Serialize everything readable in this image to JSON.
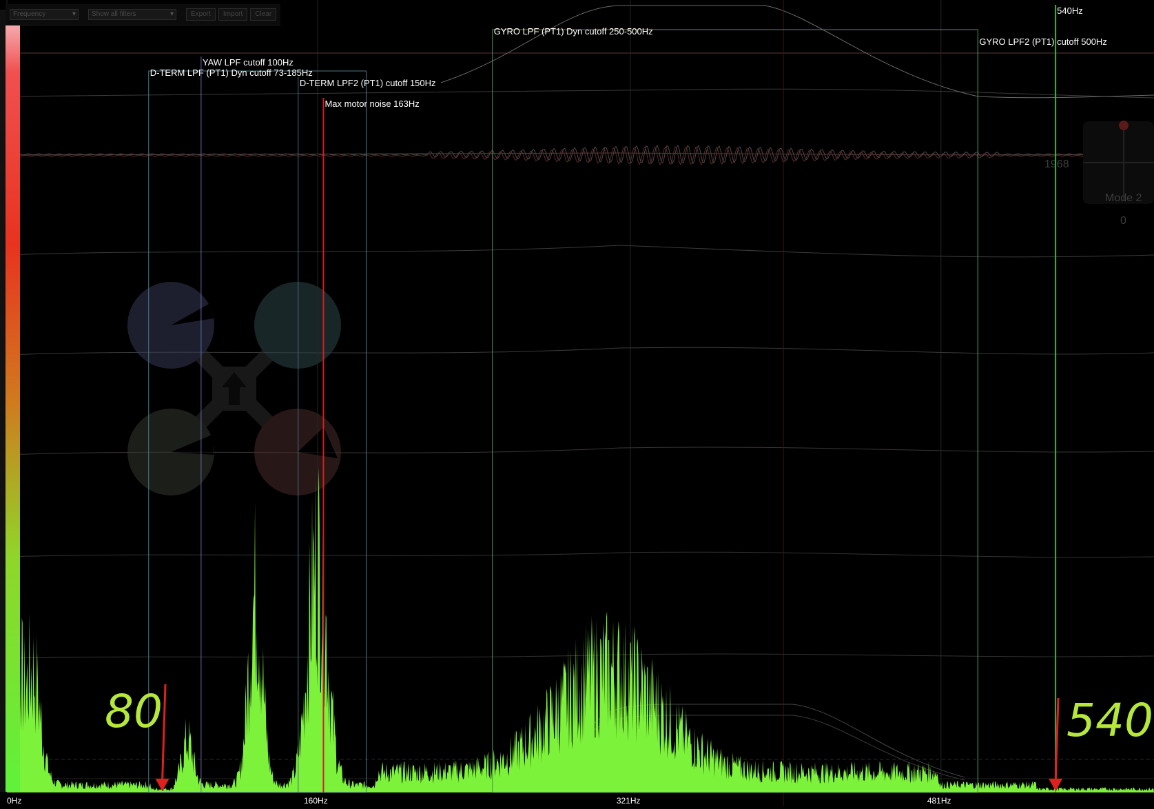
{
  "toolbar": {
    "spectrum_select": "Frequency",
    "filter_select": "Show all filters",
    "buttons": [
      "Export",
      "Import",
      "Clear"
    ]
  },
  "colors": {
    "background": "#000000",
    "spectrum": "#7df23a",
    "max_noise_marker": "#e02020",
    "gyro_lpf2_marker": "#33bb33",
    "annotation": "#b6e83a",
    "annotation_arrow": "#e02020"
  },
  "chart_data": {
    "type": "area",
    "x_axis": {
      "ticks": [
        "0Hz",
        "160Hz",
        "321Hz",
        "481Hz"
      ],
      "tick_values": [
        0,
        160,
        321,
        481
      ],
      "max": 588
    },
    "filters": [
      {
        "label": "D-TERM LPF (PT1) Dyn cutoff 73-185Hz",
        "from": 73,
        "to": 185
      },
      {
        "label": "YAW LPF cutoff 100Hz",
        "at": 100
      },
      {
        "label": "D-TERM LPF2 (PT1) cutoff 150Hz",
        "at": 150
      },
      {
        "label": "Max motor noise 163Hz",
        "at": 163
      },
      {
        "label": "GYRO LPF (PT1) Dyn cutoff 250-500Hz",
        "from": 250,
        "to": 500
      },
      {
        "label": "GYRO LPF2 (PT1) cutoff 500Hz",
        "at": 500
      },
      {
        "label": "540Hz",
        "at": 540
      }
    ],
    "peaks": [
      {
        "hz": 0,
        "amp": 1.0
      },
      {
        "hz": 13,
        "amp": 0.18
      },
      {
        "hz": 80,
        "amp": 0.005
      },
      {
        "hz": 93,
        "amp": 0.07
      },
      {
        "hz": 128,
        "amp": 0.3
      },
      {
        "hz": 160,
        "amp": 0.36
      },
      {
        "hz": 310,
        "amp": 0.16
      },
      {
        "hz": 540,
        "amp": 0.005
      }
    ]
  },
  "stick_overlay": {
    "value": "1968",
    "mode": "Mode 2",
    "zero": "0"
  },
  "annotations": [
    {
      "text": "80",
      "hz": 80
    },
    {
      "text": "540",
      "hz": 540
    }
  ]
}
